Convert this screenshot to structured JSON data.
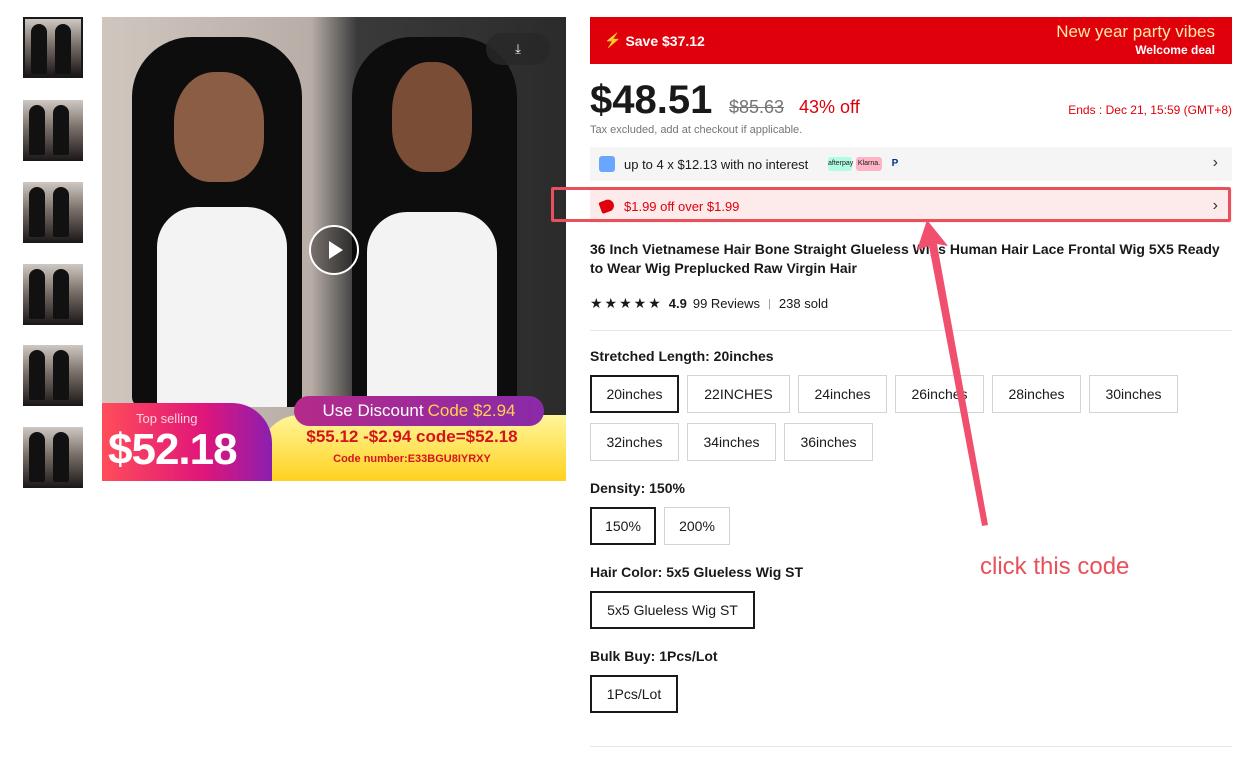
{
  "thumbnails": [
    "thumb-1",
    "thumb-2",
    "thumb-3",
    "thumb-4",
    "thumb-5",
    "thumb-6"
  ],
  "media": {
    "download_icon": "download-icon",
    "play_icon": "play-icon",
    "banner": {
      "top_selling": "Top selling",
      "big_price": "$52.18",
      "use_discount_prefix": "Use Discount",
      "use_discount_code": "Code $2.94",
      "calc": "$55.12 -$2.94 code=$52.18",
      "code_number": "Code number:E33BGU8IYRXY"
    }
  },
  "save_bar": {
    "save_text": "Save $37.12",
    "promo_title": "New year party vibes",
    "promo_sub": "Welcome deal",
    "color": "#e0000b"
  },
  "pricing": {
    "price": "$48.51",
    "original": "$85.63",
    "discount": "43% off",
    "ends": "Ends :  Dec 21, 15:59 (GMT+8)",
    "tax_note": "Tax excluded, add at checkout if applicable."
  },
  "installments": {
    "text": "up to 4 x $12.13 with no interest",
    "logos": [
      "afterpay",
      "Klarna.",
      "P"
    ]
  },
  "coupon": {
    "text": "$1.99 off over $1.99"
  },
  "product": {
    "title": "36 Inch Vietnamese Hair Bone Straight Glueless Wigs Human Hair Lace Frontal Wig 5X5 Ready to Wear Wig Preplucked Raw Virgin Hair",
    "rating": "4.9",
    "reviews": "99 Reviews",
    "sold": "238 sold"
  },
  "options": {
    "length": {
      "label": "Stretched Length:",
      "value": "20inches",
      "items": [
        "20inches",
        "22INCHES",
        "24inches",
        "26inches",
        "28inches",
        "30inches",
        "32inches",
        "34inches",
        "36inches"
      ]
    },
    "density": {
      "label": "Density:",
      "value": "150%",
      "items": [
        "150%",
        "200%"
      ]
    },
    "color": {
      "label": "Hair Color:",
      "value": "5x5 Glueless Wig ST",
      "items": [
        "5x5 Glueless Wig ST"
      ]
    },
    "bulk": {
      "label": "Bulk Buy:",
      "value": "1Pcs/Lot",
      "items": [
        "1Pcs/Lot"
      ]
    }
  },
  "annotation": {
    "text": "click this code",
    "color": "#e8505b"
  }
}
